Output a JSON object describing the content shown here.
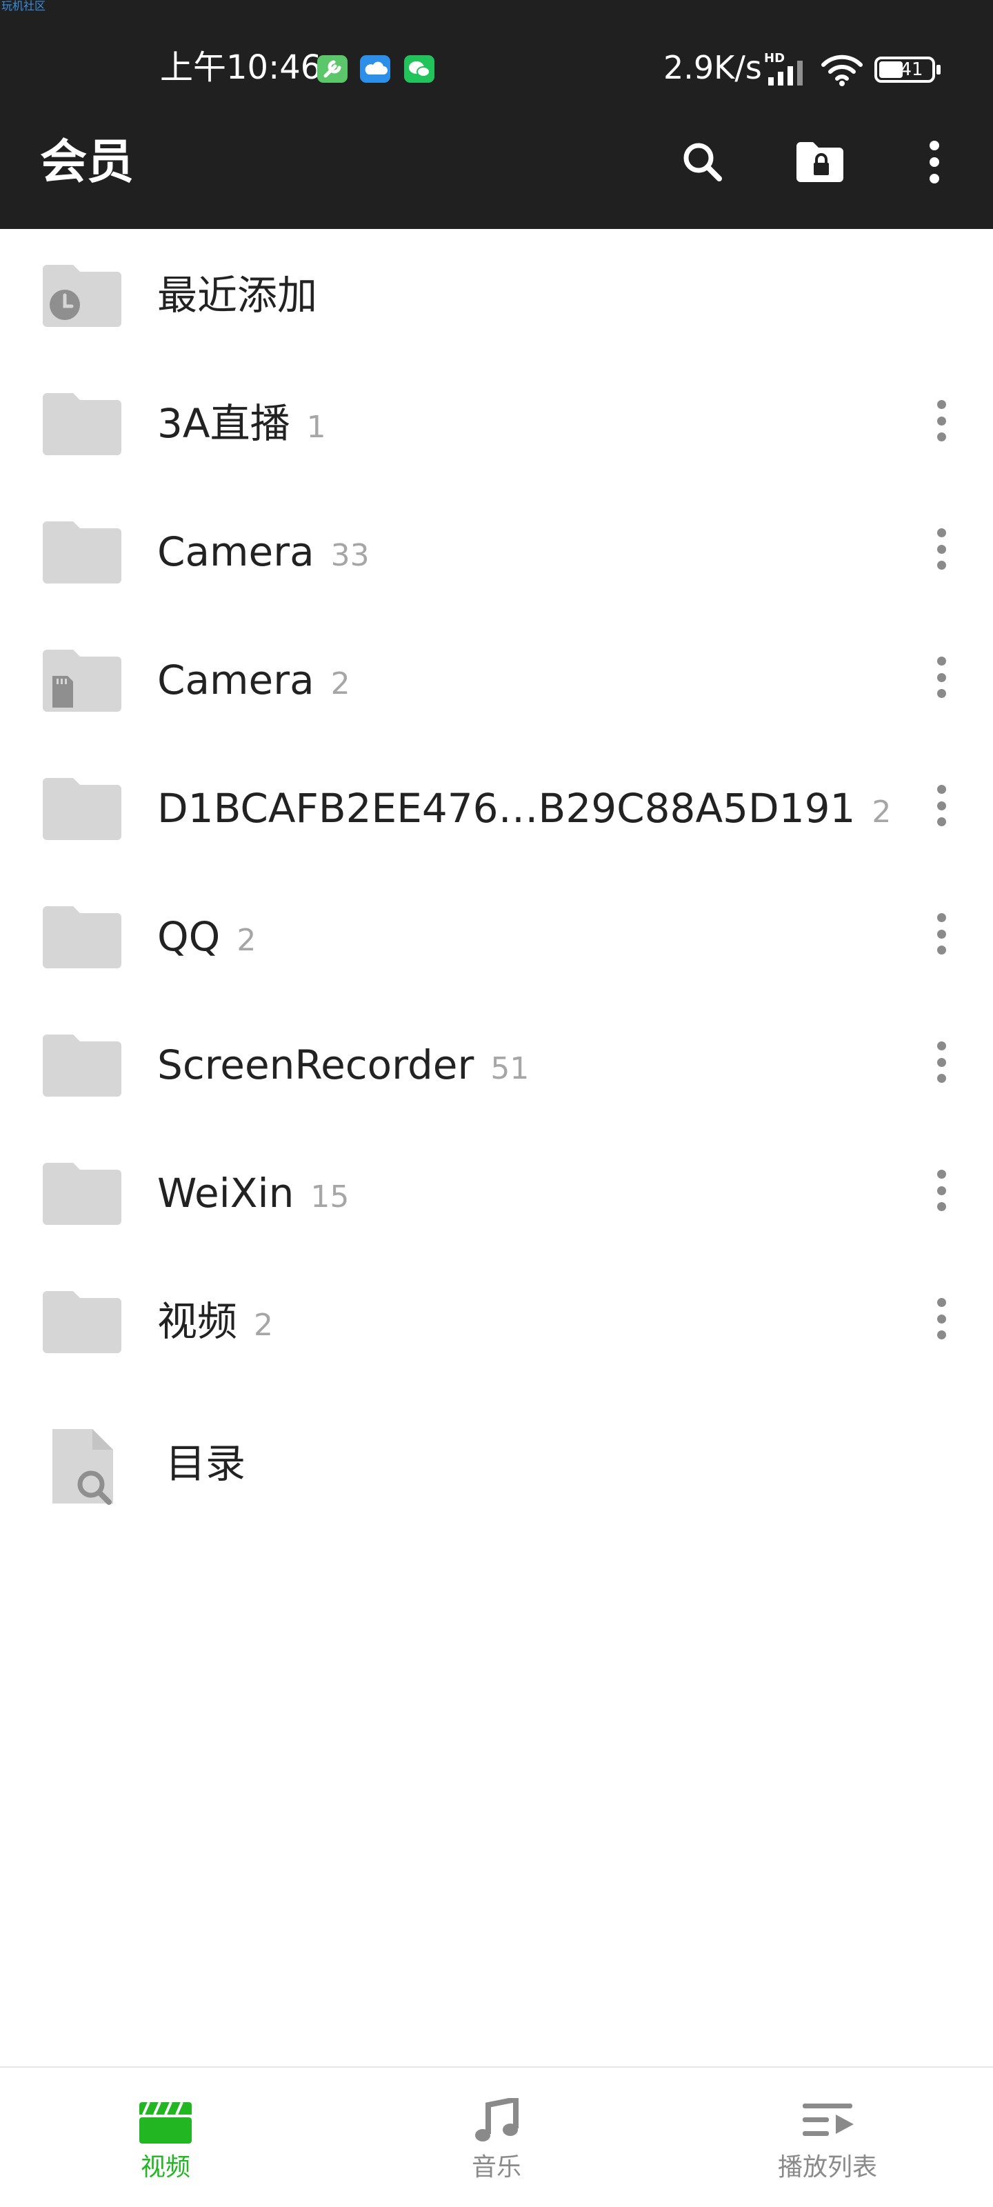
{
  "watermark": "玩机社区",
  "status_bar": {
    "time": "上午10:46",
    "network_speed": "2.9K/s",
    "network_type": "HD",
    "battery": "41"
  },
  "app_bar": {
    "title": "会员",
    "icons": [
      "search-icon",
      "folder-lock-icon",
      "more-vertical-icon"
    ]
  },
  "folders": [
    {
      "name": "最近添加",
      "count": "",
      "icon": "recent-folder-icon",
      "has_more": false
    },
    {
      "name": "3A直播",
      "count": "1",
      "icon": "folder-icon",
      "has_more": true
    },
    {
      "name": "Camera",
      "count": "33",
      "icon": "folder-icon",
      "has_more": true
    },
    {
      "name": "Camera",
      "count": "2",
      "icon": "sd-card-folder-icon",
      "has_more": true
    },
    {
      "name": "D1BCAFB2EE476…B29C88A5D191",
      "count": "2",
      "icon": "folder-icon",
      "has_more": true
    },
    {
      "name": "QQ",
      "count": "2",
      "icon": "folder-icon",
      "has_more": true
    },
    {
      "name": "ScreenRecorder",
      "count": "51",
      "icon": "folder-icon",
      "has_more": true
    },
    {
      "name": "WeiXin",
      "count": "15",
      "icon": "folder-icon",
      "has_more": true
    },
    {
      "name": "视频",
      "count": "2",
      "icon": "folder-icon",
      "has_more": true
    }
  ],
  "directory": {
    "label": "目录",
    "icon": "file-search-icon"
  },
  "bottom_nav": [
    {
      "label": "视频",
      "icon": "clapperboard-icon",
      "active": true
    },
    {
      "label": "音乐",
      "icon": "music-note-icon",
      "active": false
    },
    {
      "label": "播放列表",
      "icon": "playlist-icon",
      "active": false
    }
  ],
  "colors": {
    "topbar": "#202020",
    "accent_green": "#23b623",
    "folder_gray": "#d6d6d6",
    "count_gray": "#a6a6a6"
  }
}
